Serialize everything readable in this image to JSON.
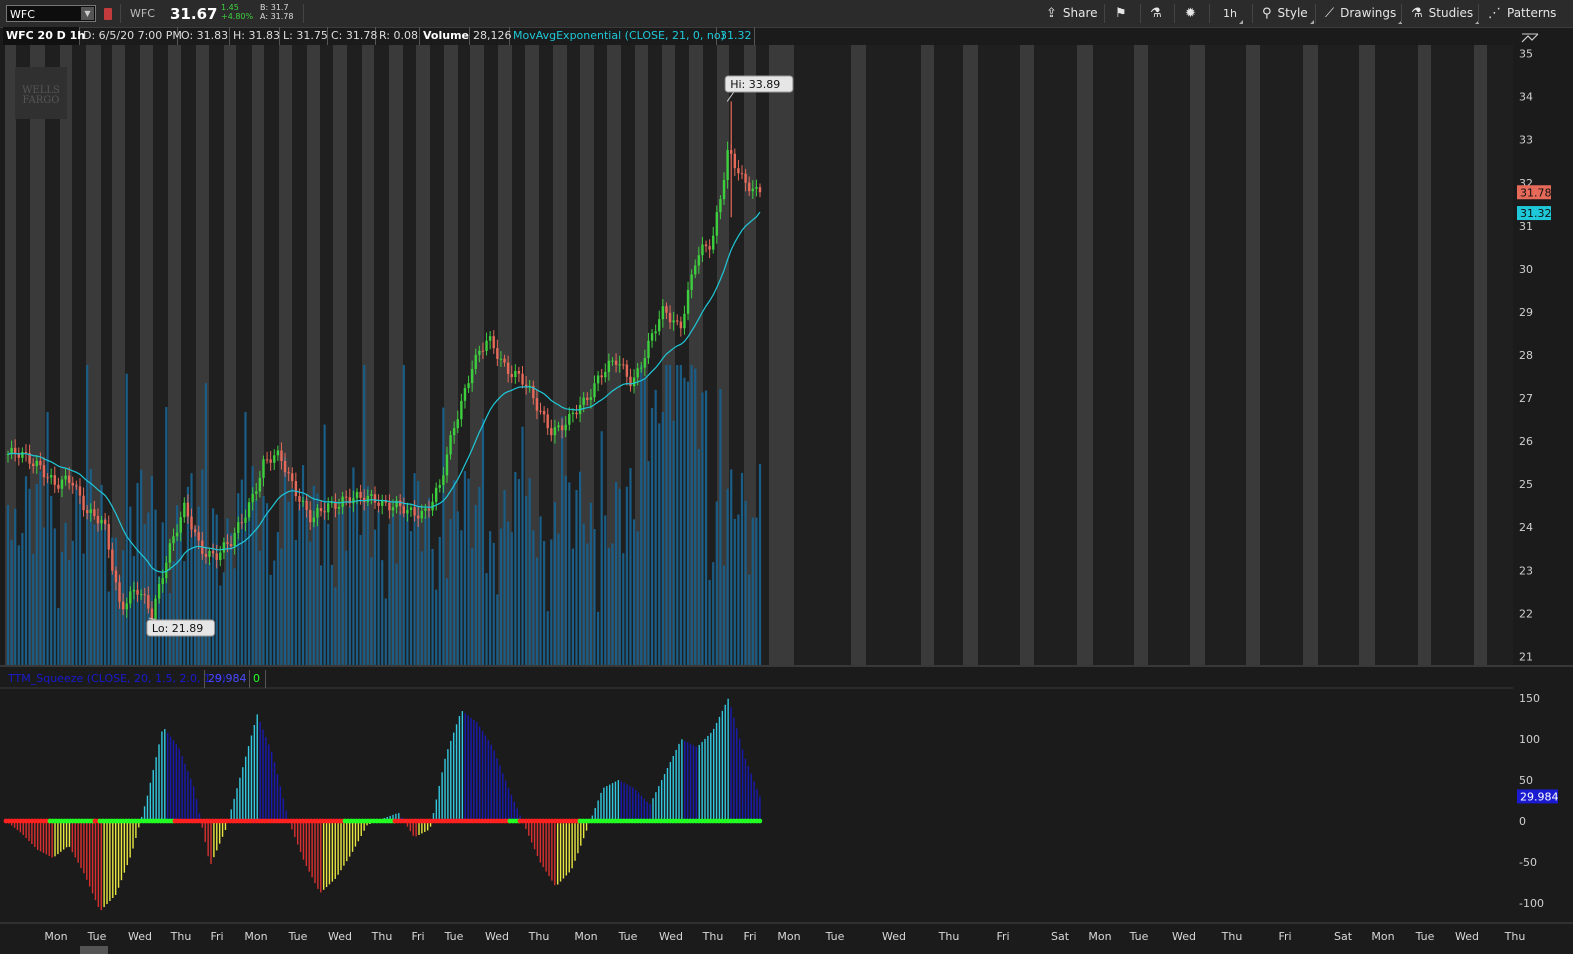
{
  "toolbar": {
    "symbol_input": "WFC",
    "symbol_name": "WFC",
    "last_price": "31.67",
    "net_change": "1.45",
    "pct_change": "+4.80%",
    "bid": "B: 31.7",
    "ask": "A: 31.78",
    "share_label": "Share",
    "timeframe_label": "1h",
    "style_label": "Style",
    "drawings_label": "Drawings",
    "studies_label": "Studies",
    "patterns_label": "Patterns",
    "icons": [
      "share-icon",
      "flag-icon",
      "beaker-icon",
      "gear-icon",
      "style-icon",
      "pencil-icon",
      "flask-icon",
      "patterns-icon"
    ]
  },
  "chart_header": {
    "symbol_period": "WFC 20 D 1h",
    "date": "D: 6/5/20 7:00 PM",
    "open": "O: 31.83",
    "high": "H: 31.83",
    "low": "L: 31.75",
    "close": "C: 31.78",
    "range": "R: 0.08",
    "volume_label": "Volume",
    "volume_value": "28,126",
    "ema_label": "MovAvgExponential (CLOSE, 21, 0, no)",
    "ema_value": "31.32"
  },
  "watermark": "WELLS FARGO",
  "study_header": {
    "label": "TTM_Squeeze (CLOSE, 20, 1.5, 2.0, 1.0)",
    "value": "29.984",
    "squeeze_value": "0"
  },
  "colors": {
    "background": "#1b1b1b",
    "session_band": "#3a3a3a",
    "up_candle": "#3ecf3e",
    "down_candle": "#e56a5a",
    "ema_line": "#1fc8d8",
    "volume": "#1a5d86",
    "histogram_up_rising": "#33c8e0",
    "histogram_up_falling": "#1a1ab0",
    "histogram_down_falling": "#d83030",
    "histogram_down_rising": "#e8e640",
    "squeeze_on": "#ff2020",
    "squeeze_off": "#22ff22"
  },
  "chart_data": [
    {
      "type": "candlestick",
      "title": "WFC 20 D 1h",
      "ylim": [
        20.8,
        35.2
      ],
      "y_ticks": [
        35,
        34,
        33,
        32,
        31,
        30,
        29,
        28,
        27,
        26,
        25,
        24,
        23,
        22,
        21
      ],
      "x_labels": [
        "Mon",
        "Tue",
        "Wed",
        "Thu",
        "Fri",
        "Mon",
        "Tue",
        "Wed",
        "Thu",
        "Fri",
        "Tue",
        "Wed",
        "Thu",
        "Mon",
        "Tue",
        "Wed",
        "Thu",
        "Fri",
        "Mon",
        "Tue",
        "Wed",
        "Thu",
        "Fri",
        "Sat",
        "Mon",
        "Tue",
        "Wed",
        "Thu",
        "Fri",
        "Sat",
        "Mon",
        "Tue",
        "Wed",
        "Thu"
      ],
      "anchor_closes": [
        25.7,
        25.6,
        25.5,
        24.9,
        25.1,
        24.4,
        24.0,
        22.2,
        22.6,
        21.9,
        23.5,
        24.4,
        23.5,
        23.4,
        23.6,
        24.5,
        25.5,
        25.6,
        24.9,
        24.1,
        24.5,
        24.7,
        24.6,
        24.7,
        24.5,
        24.3,
        24.4,
        24.9,
        26.5,
        27.8,
        28.3,
        27.8,
        27.5,
        26.8,
        26.3,
        26.4,
        26.9,
        27.6,
        27.8,
        27.4,
        28.2,
        29.0,
        28.7,
        30.2,
        30.6,
        32.8,
        31.9,
        31.78
      ],
      "hi_label": "Hi: 33.89",
      "lo_label": "Lo: 21.89",
      "last_close": 31.78,
      "last_close_label": "31.78",
      "ema_last": 31.32,
      "ema_last_label": "31.32",
      "ema_length": 21
    },
    {
      "type": "bar",
      "title": "TTM_Squeeze (CLOSE, 20, 1.5, 2.0, 1.0)",
      "ylim": [
        -118,
        170
      ],
      "y_ticks": [
        150,
        100,
        50,
        0,
        -50,
        -100
      ],
      "anchor_values": [
        0,
        -15,
        -35,
        -45,
        -30,
        -65,
        -110,
        -90,
        -40,
        30,
        115,
        90,
        40,
        -55,
        -10,
        60,
        130,
        80,
        0,
        -50,
        -88,
        -70,
        -40,
        -5,
        3,
        10,
        -20,
        -10,
        80,
        135,
        120,
        90,
        40,
        -5,
        -50,
        -80,
        -60,
        -10,
        40,
        50,
        40,
        20,
        60,
        100,
        90,
        110,
        150,
        80,
        30
      ],
      "squeeze_segments": [
        "on",
        "off",
        "on",
        "off",
        "on",
        "off",
        "on",
        "off",
        "on",
        "off"
      ],
      "last_value": 29.984,
      "last_value_label": "29.984"
    }
  ]
}
